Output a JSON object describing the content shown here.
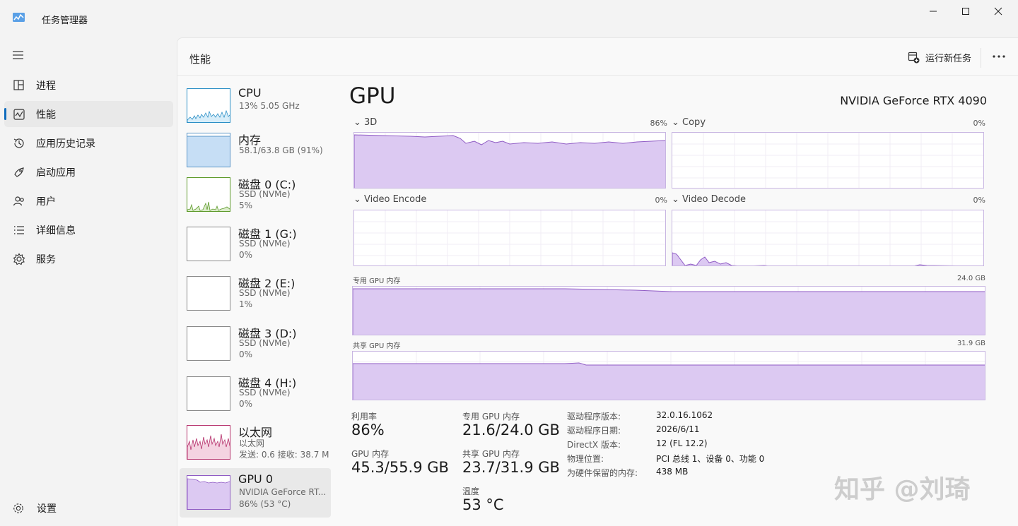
{
  "window": {
    "title": "任务管理器"
  },
  "sidebar": {
    "items": [
      {
        "label": "进程",
        "icon": "processes-icon"
      },
      {
        "label": "性能",
        "icon": "performance-icon",
        "active": true
      },
      {
        "label": "应用历史记录",
        "icon": "app-history-icon"
      },
      {
        "label": "启动应用",
        "icon": "startup-apps-icon"
      },
      {
        "label": "用户",
        "icon": "users-icon"
      },
      {
        "label": "详细信息",
        "icon": "details-icon"
      },
      {
        "label": "服务",
        "icon": "services-icon"
      }
    ],
    "settings_label": "设置"
  },
  "header": {
    "title": "性能",
    "run_task": "运行新任务"
  },
  "resources": [
    {
      "name": "CPU",
      "line1": "13%  5.05 GHz",
      "line2": ""
    },
    {
      "name": "内存",
      "line1": "58.1/63.8 GB (91%)",
      "line2": ""
    },
    {
      "name": "磁盘 0 (C:)",
      "line1": "SSD (NVMe)",
      "line2": "5%"
    },
    {
      "name": "磁盘 1 (G:)",
      "line1": "SSD (NVMe)",
      "line2": "0%"
    },
    {
      "name": "磁盘 2 (E:)",
      "line1": "SSD (NVMe)",
      "line2": "1%"
    },
    {
      "name": "磁盘 3 (D:)",
      "line1": "SSD (NVMe)",
      "line2": "0%"
    },
    {
      "name": "磁盘 4 (H:)",
      "line1": "SSD (NVMe)",
      "line2": "0%"
    },
    {
      "name": "以太网",
      "line1": "以太网",
      "line2": "发送: 0.6  接收: 38.7 M"
    },
    {
      "name": "GPU 0",
      "line1": "NVIDIA GeForce RT...",
      "line2": "86% (53 °C)"
    }
  ],
  "gpu": {
    "title": "GPU",
    "model": "NVIDIA GeForce RTX 4090",
    "charts": {
      "c3d": {
        "label": "3D",
        "pct": "86%"
      },
      "copy": {
        "label": "Copy",
        "pct": "0%"
      },
      "encode": {
        "label": "Video Encode",
        "pct": "0%"
      },
      "decode": {
        "label": "Video Decode",
        "pct": "0%"
      },
      "dedicated": {
        "label": "专用 GPU 内存",
        "max": "24.0 GB"
      },
      "shared": {
        "label": "共享 GPU 内存",
        "max": "31.9 GB"
      }
    },
    "stats": {
      "util_label": "利用率",
      "util_value": "86%",
      "gpumem_label": "GPU 内存",
      "gpumem_value": "45.3/55.9 GB",
      "ded_label": "专用 GPU 内存",
      "ded_value": "21.6/24.0 GB",
      "shared_label": "共享 GPU 内存",
      "shared_value": "23.7/31.9 GB",
      "temp_label": "温度",
      "temp_value": "53 °C"
    },
    "info": [
      {
        "k": "驱动程序版本:",
        "v": "32.0.16.1062"
      },
      {
        "k": "驱动程序日期:",
        "v": "2026/6/11"
      },
      {
        "k": "DirectX 版本:",
        "v": "12 (FL 12.2)"
      },
      {
        "k": "物理位置:",
        "v": "PCI 总线 1、设备 0、功能 0"
      },
      {
        "k": "为硬件保留的内存:",
        "v": "438 MB"
      }
    ]
  },
  "watermark": "知乎 @刘琦"
}
